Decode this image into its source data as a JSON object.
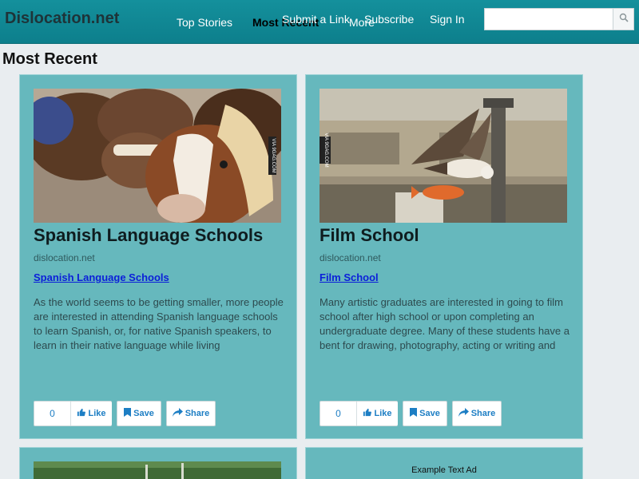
{
  "site": {
    "logo": "Dislocation.net"
  },
  "nav": {
    "top_stories": "Top Stories",
    "most_recent": "Most Recent",
    "more": "More",
    "submit_link": "Submit a Link",
    "subscribe": "Subscribe",
    "sign_in": "Sign In"
  },
  "search": {
    "value": "",
    "placeholder": ""
  },
  "page": {
    "title": "Most Recent"
  },
  "cards": [
    {
      "title": "Spanish Language Schools",
      "source": "dislocation.net",
      "link": "Spanish Language Schools",
      "description": "As the world seems to be getting smaller, more people are interested in attending Spanish language schools to learn Spanish, or, for native Spanish speakers, to learn in their native language while living",
      "image_label": "VIA 9GAG.COM",
      "like_count": "0",
      "like_label": "Like",
      "save_label": "Save",
      "share_label": "Share"
    },
    {
      "title": "Film School",
      "source": "dislocation.net",
      "link": "Film School",
      "description": "Many artistic graduates are interested in going to film school after high school or upon completing an undergraduate degree. Many of these students have a bent for drawing, photography, acting or writing and",
      "image_label": "VIA 9GAG.COM",
      "like_count": "0",
      "like_label": "Like",
      "save_label": "Save",
      "share_label": "Share"
    }
  ],
  "ad": {
    "text": "Example Text Ad"
  },
  "colors": {
    "header": "#14909c",
    "card": "#66b8bd",
    "link": "#0b1fd9",
    "action": "#1d7ec4"
  }
}
